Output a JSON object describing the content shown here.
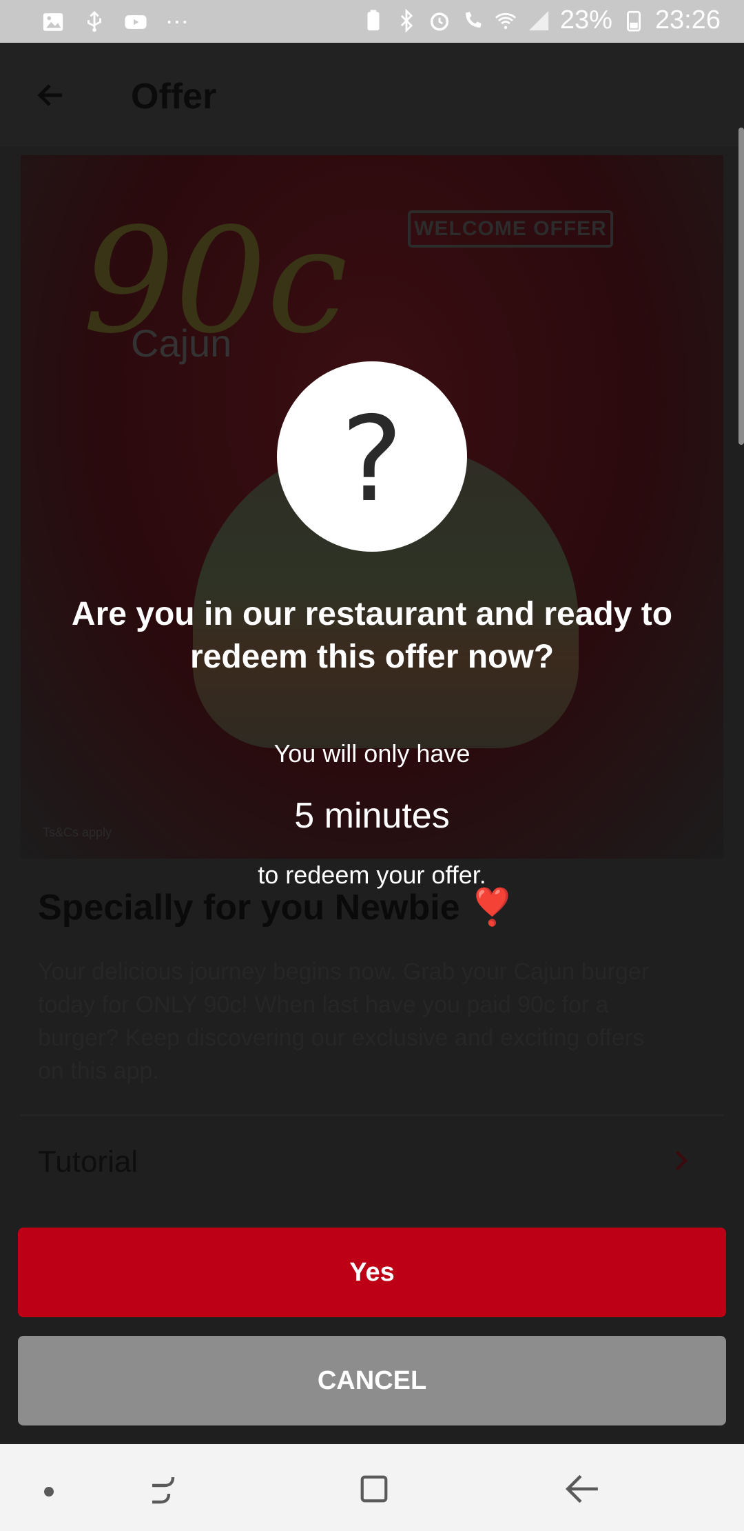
{
  "status_bar": {
    "battery": "23%",
    "time": "23:26",
    "more": "⋯"
  },
  "appbar": {
    "title": "Offer"
  },
  "hero": {
    "price_text": "90c",
    "product_name": "Cajun",
    "badge": "WELCOME OFFER",
    "terms": "Ts&Cs apply"
  },
  "offer": {
    "heading": "Specially for you Newbie ❣️",
    "description": "Your delicious journey begins now. Grab your Cajun burger today for ONLY 90c! When last have you paid 90c for a burger? Keep discovering our exclusive and exciting offers on this app."
  },
  "list": {
    "tutorial": "Tutorial"
  },
  "modal": {
    "icon_glyph": "?",
    "title": "Are you in our restaurant and ready to redeem this offer now?",
    "line1": "You will only have",
    "minutes": "5 minutes",
    "line2": "to redeem your offer.",
    "yes_label": "Yes",
    "cancel_label": "CANCEL"
  },
  "colors": {
    "accent": "#be0017",
    "cancel": "#8d8d8d"
  }
}
